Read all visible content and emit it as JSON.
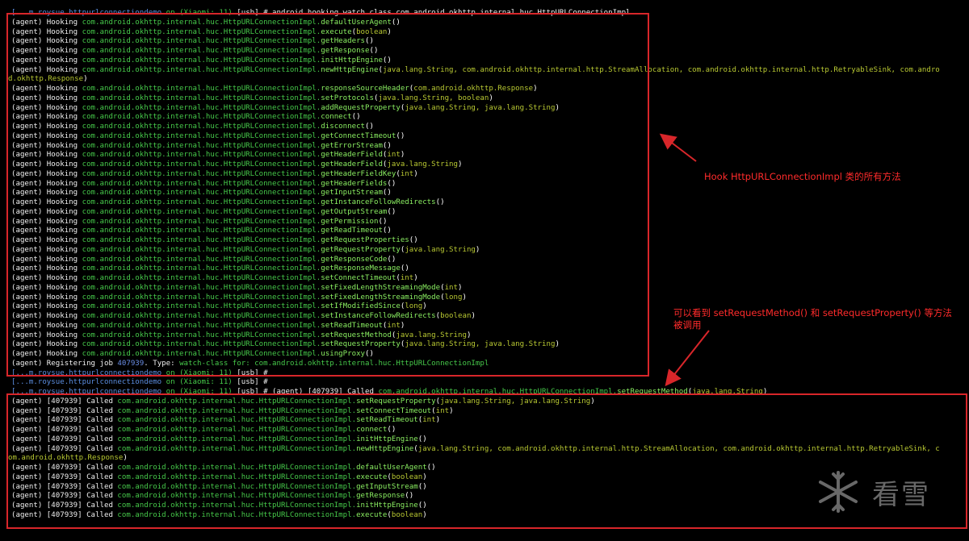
{
  "terminal": {
    "lines": [
      {
        "kind": "prompt",
        "path": "[...m.roysue.httpurlconnectiondemo",
        "device": "on (Xiaomi: 11)",
        "usb": "[usb] #",
        "cmd": "android hooking watch class com.android.okhttp.internal.huc.HttpURLConnectionImpl"
      },
      {
        "kind": "hook",
        "m": "defaultUserAgent",
        "a": ""
      },
      {
        "kind": "hook",
        "m": "execute",
        "a": "boolean"
      },
      {
        "kind": "hook",
        "m": "getHeaders",
        "a": ""
      },
      {
        "kind": "hook",
        "m": "getResponse",
        "a": ""
      },
      {
        "kind": "hook",
        "m": "initHttpEngine",
        "a": ""
      },
      {
        "kind": "hook",
        "m": "newHttpEngine",
        "a": "java.lang.String, com.android.okhttp.internal.http.StreamAllocation, com.android.okhttp.internal.http.RetryableSink, com.andro"
      },
      {
        "kind": "wrap",
        "text": "d.okhttp.Response)"
      },
      {
        "kind": "hook",
        "m": "responseSourceHeader",
        "a": "com.android.okhttp.Response"
      },
      {
        "kind": "hook",
        "m": "setProtocols",
        "a": "java.lang.String, boolean"
      },
      {
        "kind": "hook",
        "m": "addRequestProperty",
        "a": "java.lang.String, java.lang.String"
      },
      {
        "kind": "hook",
        "m": "connect",
        "a": ""
      },
      {
        "kind": "hook",
        "m": "disconnect",
        "a": ""
      },
      {
        "kind": "hook",
        "m": "getConnectTimeout",
        "a": ""
      },
      {
        "kind": "hook",
        "m": "getErrorStream",
        "a": ""
      },
      {
        "kind": "hook",
        "m": "getHeaderField",
        "a": "int"
      },
      {
        "kind": "hook",
        "m": "getHeaderField",
        "a": "java.lang.String"
      },
      {
        "kind": "hook",
        "m": "getHeaderFieldKey",
        "a": "int"
      },
      {
        "kind": "hook",
        "m": "getHeaderFields",
        "a": ""
      },
      {
        "kind": "hook",
        "m": "getInputStream",
        "a": ""
      },
      {
        "kind": "hook",
        "m": "getInstanceFollowRedirects",
        "a": ""
      },
      {
        "kind": "hook",
        "m": "getOutputStream",
        "a": ""
      },
      {
        "kind": "hook",
        "m": "getPermission",
        "a": ""
      },
      {
        "kind": "hook",
        "m": "getReadTimeout",
        "a": ""
      },
      {
        "kind": "hook",
        "m": "getRequestProperties",
        "a": ""
      },
      {
        "kind": "hook",
        "m": "getRequestProperty",
        "a": "java.lang.String"
      },
      {
        "kind": "hook",
        "m": "getResponseCode",
        "a": ""
      },
      {
        "kind": "hook",
        "m": "getResponseMessage",
        "a": ""
      },
      {
        "kind": "hook",
        "m": "setConnectTimeout",
        "a": "int"
      },
      {
        "kind": "hook",
        "m": "setFixedLengthStreamingMode",
        "a": "int"
      },
      {
        "kind": "hook",
        "m": "setFixedLengthStreamingMode",
        "a": "long"
      },
      {
        "kind": "hook",
        "m": "setIfModifiedSince",
        "a": "long"
      },
      {
        "kind": "hook",
        "m": "setInstanceFollowRedirects",
        "a": "boolean"
      },
      {
        "kind": "hook",
        "m": "setReadTimeout",
        "a": "int"
      },
      {
        "kind": "hook",
        "m": "setRequestMethod",
        "a": "java.lang.String"
      },
      {
        "kind": "hook",
        "m": "setRequestProperty",
        "a": "java.lang.String, java.lang.String"
      },
      {
        "kind": "hook",
        "m": "usingProxy",
        "a": ""
      },
      {
        "kind": "register",
        "pre": "(agent) Registering job ",
        "job": "407939",
        "mid": ". Type: ",
        "type": "watch-class for: com.android.okhttp.internal.huc.HttpURLConnectionImpl"
      },
      {
        "kind": "prompt",
        "path": "[...m.roysue.httpurlconnectiondemo",
        "device": "on (Xiaomi: 11)",
        "usb": "[usb] #",
        "cmd": ""
      },
      {
        "kind": "prompt",
        "path": "[...m.roysue.httpurlconnectiondemo",
        "device": "on (Xiaomi: 11)",
        "usb": "[usb] #",
        "cmd": ""
      },
      {
        "kind": "promptcall",
        "path": "[...m.roysue.httpurlconnectiondemo",
        "device": "on (Xiaomi: 11)",
        "usb": "[usb] #",
        "pre": "(agent) [407939] Called ",
        "m": "setRequestMethod",
        "a": "java.lang.String"
      },
      {
        "kind": "called",
        "m": "setRequestProperty",
        "a": "java.lang.String, java.lang.String"
      },
      {
        "kind": "called",
        "m": "setConnectTimeout",
        "a": "int"
      },
      {
        "kind": "called",
        "m": "setReadTimeout",
        "a": "int"
      },
      {
        "kind": "called",
        "m": "connect",
        "a": ""
      },
      {
        "kind": "called",
        "m": "initHttpEngine",
        "a": ""
      },
      {
        "kind": "called",
        "m": "newHttpEngine",
        "a": "java.lang.String, com.android.okhttp.internal.http.StreamAllocation, com.android.okhttp.internal.http.RetryableSink, c"
      },
      {
        "kind": "wrap",
        "text": "om.android.okhttp.Response)"
      },
      {
        "kind": "called",
        "m": "defaultUserAgent",
        "a": ""
      },
      {
        "kind": "called",
        "m": "execute",
        "a": "boolean"
      },
      {
        "kind": "called",
        "m": "getInputStream",
        "a": ""
      },
      {
        "kind": "called",
        "m": "getResponse",
        "a": ""
      },
      {
        "kind": "called",
        "m": "initHttpEngine",
        "a": ""
      },
      {
        "kind": "called",
        "m": "execute",
        "a": "boolean"
      }
    ],
    "hook_prefix": "(agent) Hooking ",
    "called_prefix": "(agent) [407939] Called ",
    "class_name": "com.android.okhttp.internal.huc.HttpURLConnectionImpl."
  },
  "annotations": {
    "note1": "Hook HttpURLConnectionImpl 类的所有方法",
    "note2_line1": "可以看到 setRequestMethod() 和 setRequestProperty() 等方法",
    "note2_line2": "被调用"
  },
  "logo": {
    "text": "看雪"
  },
  "colors": {
    "accent_red": "#d8262a",
    "method_green": "#8bf062",
    "class_green": "#46c94a",
    "arg_yellow": "#b8c832",
    "path_blue": "#5b8ddf"
  }
}
